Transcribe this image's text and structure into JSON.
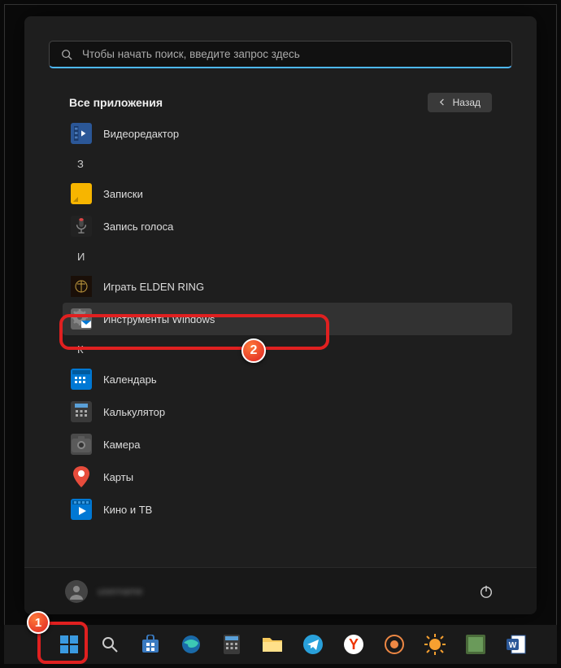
{
  "search": {
    "placeholder": "Чтобы начать поиск, введите запрос здесь"
  },
  "header": {
    "title": "Все приложения",
    "back_label": "Назад"
  },
  "letters": {
    "z": "З",
    "i": "И",
    "k": "К"
  },
  "apps": {
    "video_editor": "Видеоредактор",
    "notes": "Записки",
    "voice_recorder": "Запись голоса",
    "elden_ring": "Играть ELDEN RING",
    "windows_tools": "Инструменты Windows",
    "calendar": "Календарь",
    "calculator": "Калькулятор",
    "camera": "Камера",
    "maps": "Карты",
    "movies_tv": "Кино и ТВ"
  },
  "user": {
    "name": "username"
  },
  "callouts": {
    "one": "1",
    "two": "2"
  }
}
